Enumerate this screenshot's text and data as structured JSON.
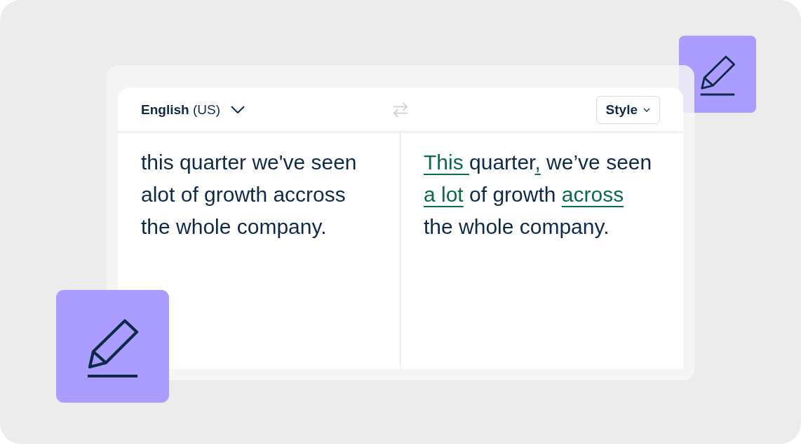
{
  "editor": {
    "source_language": {
      "label": "**English** (US)"
    },
    "swap": {
      "disabled": true
    },
    "style_button": {
      "label": "Style"
    },
    "input_text": "this quarter we've seen alot of growth accross the whole company.",
    "corrected_text": [
      {
        "text": "This ",
        "changed": true
      },
      {
        "text": "quarter",
        "changed": false
      },
      {
        "text": ",",
        "changed": true
      },
      {
        "text": " we’ve seen ",
        "changed": false
      },
      {
        "text": "a lot",
        "changed": true
      },
      {
        "text": " of growth ",
        "changed": false
      },
      {
        "text": "across",
        "changed": true
      },
      {
        "text": " the whole company.",
        "changed": false
      }
    ]
  }
}
